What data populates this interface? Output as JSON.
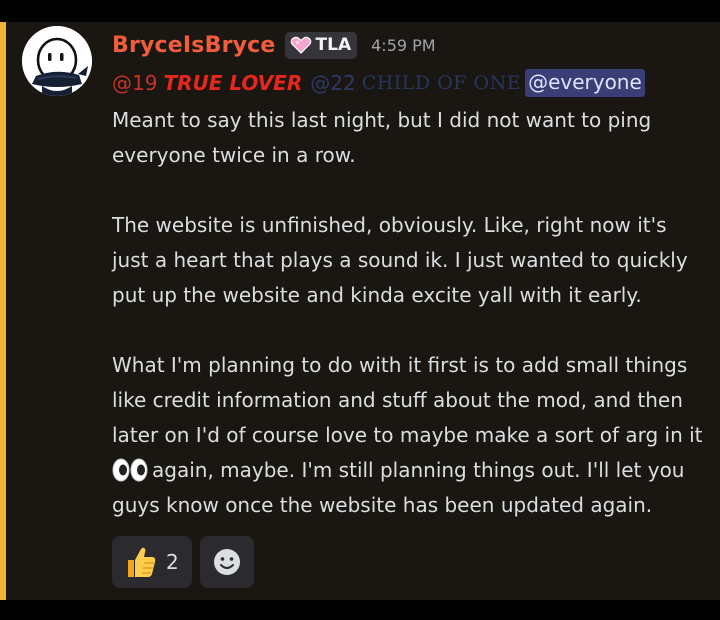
{
  "message": {
    "author": "BryceIsBryce",
    "tag_text": "TLA",
    "timestamp": "4:59 PM",
    "mentions": {
      "first_number": "@19",
      "first_role": "TRUE LOVER",
      "second_number": "@22",
      "second_role": "CHILD OF ONE",
      "everyone": "@everyone"
    },
    "paragraphs": [
      [
        "Meant to say this last night, but I did not want to ping",
        "everyone twice in a row."
      ],
      [
        "The website is unfinished, obviously. Like, right now it's",
        "just a heart that plays a sound ik. I just wanted to quickly",
        "put up the website and kinda excite yall with it early."
      ],
      [
        "What I'm planning to do with it first is to add small things",
        "like credit information and stuff about the mod, and then",
        "later on I'd of course love to maybe make a sort of arg in it",
        "again, maybe. I'm still planning things out. I'll let you",
        "guys know once the website has been updated again."
      ]
    ]
  },
  "reactions": [
    {
      "icon": "thumbs-up-icon",
      "count": "2"
    },
    {
      "icon": "add-reaction-icon"
    }
  ],
  "colors": {
    "accent_bar": "#f0b232",
    "username": "#f25d3b",
    "everyone_mention_bg": "#3a3d76",
    "message_bg": "#1a1712"
  }
}
